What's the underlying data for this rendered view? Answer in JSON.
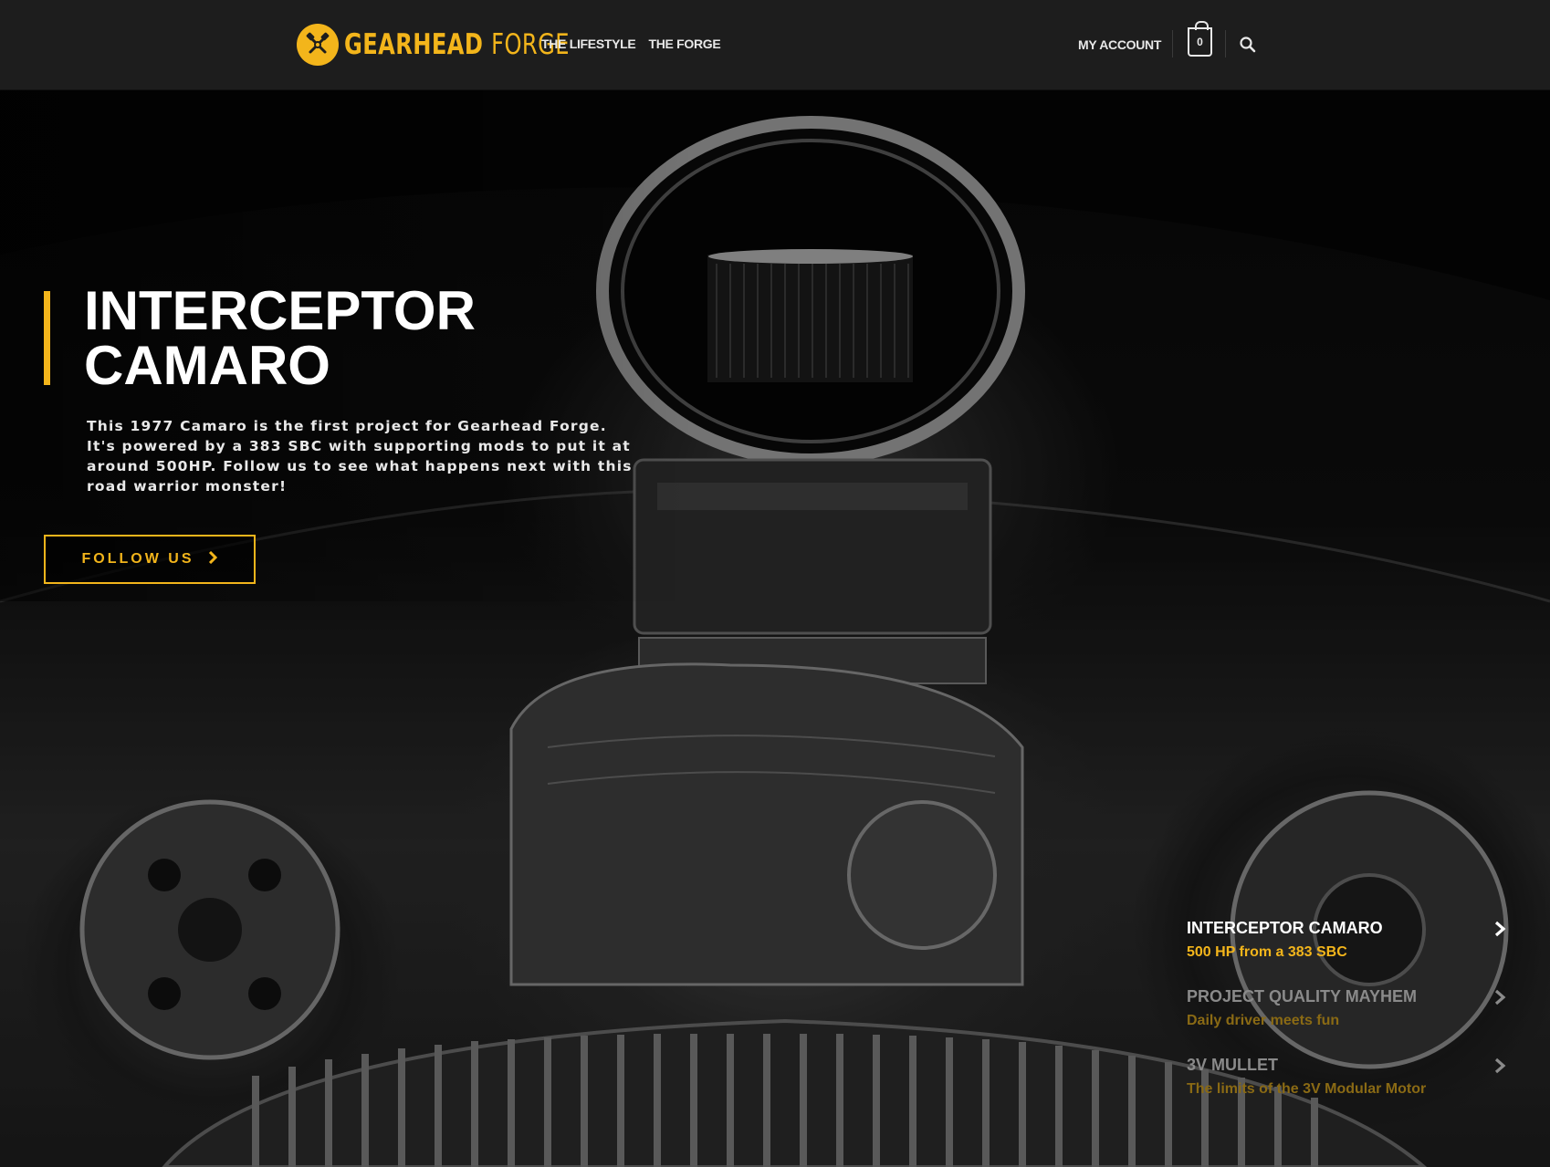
{
  "brand": {
    "name_bold": "GEARHEAD",
    "name_thin": "FORGE",
    "accent_color": "#f3b51b",
    "logo_icon": "crossed-pistons-icon"
  },
  "nav": {
    "items": [
      {
        "label": "THE LIFESTYLE"
      },
      {
        "label": "THE FORGE"
      }
    ]
  },
  "header_right": {
    "account_label": "MY ACCOUNT",
    "cart_count": "0",
    "cart_icon": "shopping-bag-icon",
    "search_icon": "search-icon"
  },
  "hero": {
    "title_line1": "INTERCEPTOR",
    "title_line2": "CAMARO",
    "description": "This 1977 Camaro is the first project for Gearhead Forge. It's powered by a 383 SBC with supporting mods to put it at around 500HP. Follow us to see what happens next with this road warrior monster!",
    "button_label": "FOLLOW US",
    "button_icon": "chevron-right-icon"
  },
  "slides": [
    {
      "title": "INTERCEPTOR CAMARO",
      "subtitle": "500 HP from a 383 SBC",
      "active": true
    },
    {
      "title": "PROJECT QUALITY MAYHEM",
      "subtitle": "Daily driver meets fun",
      "active": false
    },
    {
      "title": "3V MULLET",
      "subtitle": "The limits of the 3V Modular Motor",
      "active": false
    }
  ]
}
